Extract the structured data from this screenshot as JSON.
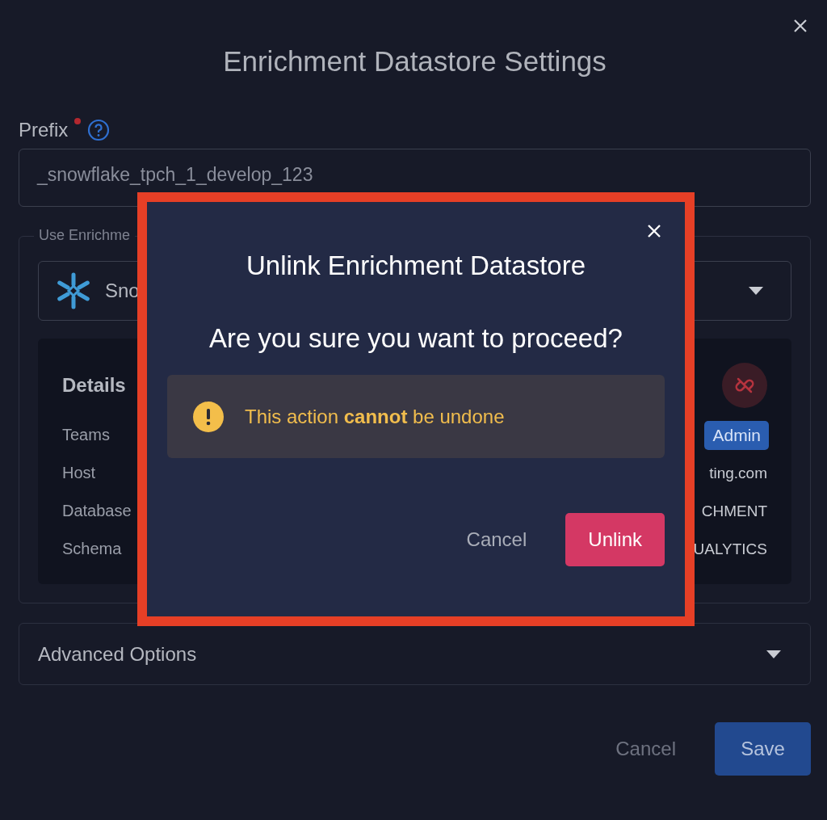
{
  "dialog": {
    "title": "Enrichment Datastore Settings",
    "prefix": {
      "label": "Prefix",
      "required": true,
      "value": "_snowflake_tpch_1_develop_123"
    },
    "datastore_group": {
      "legend": "Use Enrichme",
      "select_value": "Sno",
      "details": {
        "title": "Details",
        "rows": [
          {
            "label": "Teams",
            "value": "Admin",
            "kind": "tag"
          },
          {
            "label": "Host",
            "value": "ting.com",
            "kind": "text"
          },
          {
            "label": "Database",
            "value": "CHMENT",
            "kind": "text"
          },
          {
            "label": "Schema",
            "value": "UALYTICS",
            "kind": "text"
          }
        ]
      }
    },
    "advanced_options": {
      "label": "Advanced Options",
      "expanded": false
    },
    "buttons": [
      {
        "label": "Cancel",
        "kind": "secondary"
      },
      {
        "label": "Save",
        "kind": "primary"
      }
    ]
  },
  "modal": {
    "title": "Unlink Enrichment Datastore",
    "question": "Are you sure you want to proceed?",
    "warning": "This action **cannot** be undone",
    "buttons": [
      {
        "label": "Cancel",
        "kind": "secondary"
      },
      {
        "label": "Unlink",
        "kind": "danger"
      }
    ]
  }
}
